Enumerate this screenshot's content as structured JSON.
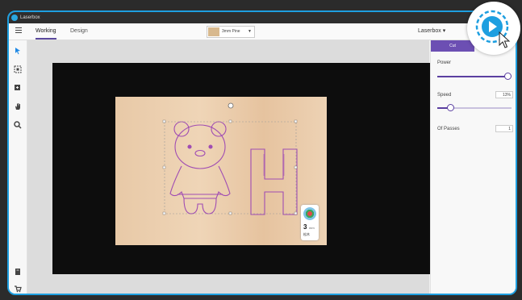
{
  "titlebar": {
    "app_title": "Laserbox"
  },
  "toolbar": {
    "tabs": [
      {
        "label": "Working"
      },
      {
        "label": "Design"
      }
    ],
    "material": {
      "name": "3mm Pine",
      "caret": "▼"
    },
    "device": {
      "label": "Laserbox ▾"
    }
  },
  "left_tools": [
    {
      "icon": "select-arrow-icon"
    },
    {
      "icon": "scan-icon"
    },
    {
      "icon": "add-shape-icon"
    },
    {
      "icon": "pan-hand-icon"
    },
    {
      "icon": "zoom-icon"
    },
    {
      "icon": "book-icon"
    },
    {
      "icon": "cart-icon"
    }
  ],
  "material_badge": {
    "thickness": "3",
    "unit": "mm",
    "material": "松木"
  },
  "panel": {
    "cut_tab": "Cut",
    "power_label": "Power",
    "power_value_fraction": 0.95,
    "speed_label": "Speed",
    "speed_value": "13%",
    "speed_value_fraction": 0.17,
    "passes_label": "Of Passes",
    "passes_value": "1"
  },
  "colors": {
    "accent": "#5b3fa0",
    "frame": "#1e9fe0",
    "start_button": "#1e9fe0"
  }
}
